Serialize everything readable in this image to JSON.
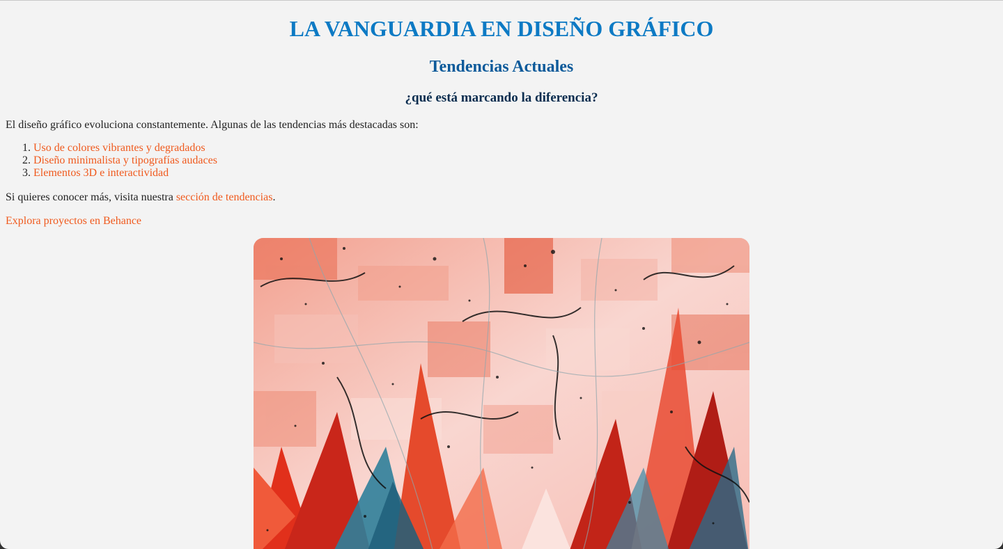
{
  "header": {
    "title": "LA VANGUARDIA EN DISEÑO GRÁFICO",
    "subtitle": "Tendencias Actuales",
    "question": "¿qué está marcando la diferencia?"
  },
  "content": {
    "intro": "El diseño gráfico evoluciona constantemente. Algunas de las tendencias más destacadas son:",
    "trends": [
      "Uso de colores vibrantes y degradados",
      "Diseño minimalista y tipografías audaces",
      "Elementos 3D e interactividad"
    ],
    "more_prefix": "Si quieres conocer más, visita nuestra ",
    "more_link": "sección de tendencias",
    "more_suffix": ".",
    "behance_link": "Explora proyectos en Behance"
  },
  "colors": {
    "title": "#0d7ac4",
    "subtitle": "#0d5a9a",
    "question": "#0b2d4f",
    "link": "#f05a1e",
    "background": "#f3f3f3"
  },
  "hero_image": {
    "icon": "abstract-art-image"
  }
}
